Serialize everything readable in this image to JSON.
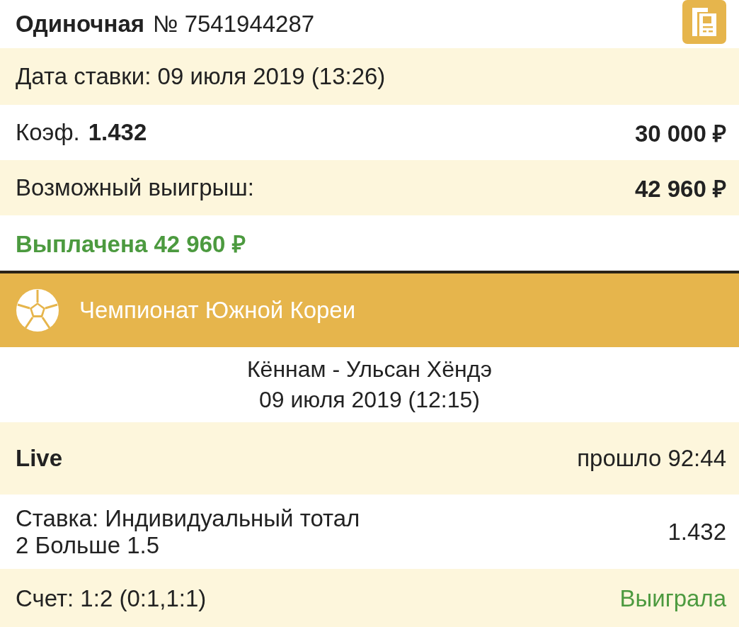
{
  "header": {
    "type": "Одиночная",
    "number": "№ 7541944287"
  },
  "date": "Дата ставки: 09 июля 2019 (13:26)",
  "coef": {
    "label": "Коэф.",
    "value": "1.432",
    "stake": "30 000 ₽"
  },
  "possible_win": {
    "label": "Возможный выигрыш:",
    "value": "42 960 ₽"
  },
  "payout": "Выплачена 42 960 ₽",
  "league": "Чемпионат Южной Кореи",
  "match": {
    "teams": "Кённам - Ульсан Хёндэ",
    "date": "09 июля 2019 (12:15)"
  },
  "live": {
    "label": "Live",
    "elapsed": "прошло 92:44"
  },
  "bet": {
    "lines": [
      "Ставка: Индивидуальный тотал",
      "2 Больше 1.5"
    ],
    "odds": "1.432"
  },
  "score": {
    "text": "Счет: 1:2 (0:1,1:1)",
    "result": "Выиграла"
  }
}
